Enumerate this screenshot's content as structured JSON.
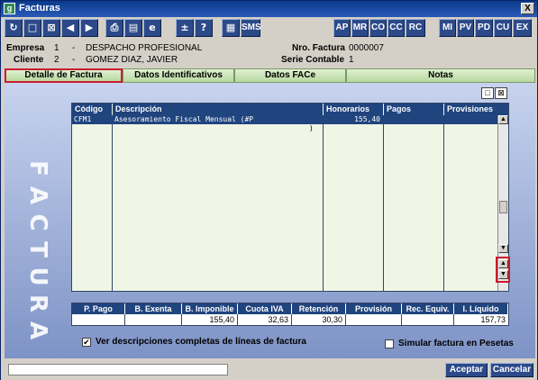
{
  "window": {
    "title": "Facturas",
    "app_icon": "app-icon",
    "close_label": "X"
  },
  "toolbar": {
    "icons": [
      "refresh-icon",
      "new-icon",
      "delete-icon",
      "prev-icon",
      "next-icon",
      "print-icon",
      "list-icon",
      "browser-icon",
      "calc-icon",
      "help-icon",
      "calendar-icon"
    ],
    "sms_label": "SMS",
    "right_buttons": [
      "AP",
      "MR",
      "CO",
      "CC",
      "RC",
      "MI",
      "PV",
      "PD",
      "CU",
      "EX"
    ]
  },
  "header": {
    "empresa_label": "Empresa",
    "empresa_code": "1",
    "empresa_dash": "-",
    "empresa_name": "DESPACHO PROFESIONAL",
    "cliente_label": "Cliente",
    "cliente_code": "2",
    "cliente_dash": "-",
    "cliente_name": "GOMEZ DIAZ, JAVIER",
    "nro_factura_label": "Nro. Factura",
    "nro_factura_value": "0000007",
    "serie_label": "Serie Contable",
    "serie_value": "1"
  },
  "tabs": [
    "Detalle de Factura",
    "Datos Identificativos",
    "Datos FACe",
    "Notas"
  ],
  "watermark": "FACTURA",
  "grid": {
    "columns": [
      "Código",
      "Descripción",
      "Honorarios",
      "Pagos",
      "Provisiones"
    ],
    "rows": [
      {
        "codigo": "CFM1",
        "descripcion": "Asesoramiento Fiscal Mensual (#P",
        "descripcion_cont": ")",
        "honorarios": "155,40",
        "pagos": "",
        "provisiones": ""
      }
    ]
  },
  "summary": {
    "headers": [
      "P. Pago",
      "B. Exenta",
      "B. Imponible",
      "Cuota IVA",
      "Retención",
      "Provisión",
      "Rec. Equiv.",
      "I. Líquido"
    ],
    "values": [
      "",
      "",
      "155,40",
      "32,63",
      "30,30",
      "",
      "",
      "157,73"
    ]
  },
  "options": {
    "ver_descripciones_label": "Ver descripciones completas de líneas de factura",
    "ver_descripciones_checked": true,
    "simular_pesetas_label": "Simular factura en Pesetas",
    "simular_pesetas_checked": false
  },
  "footer": {
    "status_text": "",
    "accept_label": "Aceptar",
    "cancel_label": "Cancelar"
  },
  "colors": {
    "title_bar": "#0a3a8a",
    "button_blue": "#2c4a8a",
    "header_blue": "#20447e",
    "tab_green": "#b8d8a0",
    "active_tab_border": "#cc1b2d",
    "panel_top": "#c7d3ee",
    "panel_bottom": "#7e93c6"
  }
}
